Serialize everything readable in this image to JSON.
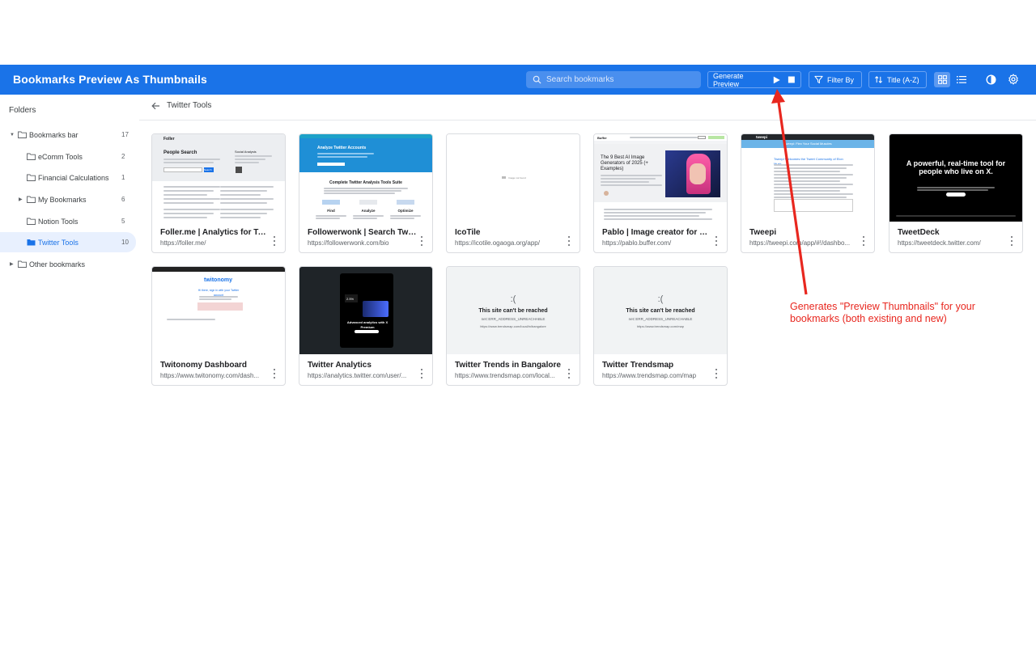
{
  "app": {
    "title": "Bookmarks Preview As Thumbnails"
  },
  "search": {
    "placeholder": "Search bookmarks"
  },
  "toolbar": {
    "generate_label": "Generate Preview",
    "filter_label": "Filter By",
    "sort_label": "Title (A-Z)"
  },
  "sidebar": {
    "heading": "Folders",
    "items": [
      {
        "label": "Bookmarks bar",
        "count": "17",
        "level": 0,
        "expanded": true
      },
      {
        "label": "eComm Tools",
        "count": "2",
        "level": 1
      },
      {
        "label": "Financial Calculations",
        "count": "1",
        "level": 1
      },
      {
        "label": "My Bookmarks",
        "count": "6",
        "level": 1,
        "collapsed": true
      },
      {
        "label": "Notion Tools",
        "count": "5",
        "level": 1
      },
      {
        "label": "Twitter Tools",
        "count": "10",
        "level": 1,
        "active": true
      },
      {
        "label": "Other bookmarks",
        "count": "",
        "level": 0,
        "collapsed": true
      }
    ]
  },
  "breadcrumb": {
    "current": "Twitter Tools"
  },
  "bookmarks": [
    {
      "title": "Foller.me | Analytics for Twit...",
      "url": "https://foller.me/",
      "thumb": {
        "brand": "Foller",
        "heading": "People Search",
        "side": "Social Analysis",
        "button": "Search"
      }
    },
    {
      "title": "Followerwonk | Search Twitt...",
      "url": "https://followerwonk.com/bio",
      "thumb": {
        "heading": "Analyze Twitter Accounts",
        "section": "Complete Twitter Analysis Tools Suite",
        "cols": [
          "Find",
          "Analyze",
          "Optimize"
        ]
      }
    },
    {
      "title": "IcoTile",
      "url": "https://icotile.ogaoga.org/app/",
      "thumb": {
        "text": "Image not found"
      }
    },
    {
      "title": "Pablo | Image creator for soc...",
      "url": "https://pablo.buffer.com/",
      "thumb": {
        "brand": "Buffer",
        "heading": "The 9 Best AI Image Generators of 2025 (+ Examples)"
      }
    },
    {
      "title": "Tweepi",
      "url": "https://tweepi.com/app/#!/dashbo...",
      "thumb": {
        "brand": "tweepi",
        "banner": "Tweepi: Flex Your Social Muscles",
        "heading": "Tweepi Welcomes the Tweet Community of Elon Musk"
      }
    },
    {
      "title": "TweetDeck",
      "url": "https://tweetdeck.twitter.com/",
      "thumb": {
        "heading": "A powerful, real-time tool for people who live on X."
      }
    },
    {
      "title": "Twitonomy Dashboard",
      "url": "https://www.twitonomy.com/dash...",
      "thumb": {
        "brand": "twitonomy",
        "heading": "Hi there, sign in with your Twitter account"
      }
    },
    {
      "title": "Twitter Analytics",
      "url": "https://analytics.twitter.com/user/...",
      "thumb": {
        "heading": "Advanced analytics with X Premium",
        "stat": "2.5%"
      }
    },
    {
      "title": "Twitter Trends in Bangalore",
      "url": "https://www.trendsmap.com/local...",
      "thumb": {
        "face": ":(",
        "error": "This site can't be reached",
        "code": "net::ERR_ADDRESS_UNREACHABLE",
        "url": "https://www.trendsmap.com/local/in/bangalore"
      }
    },
    {
      "title": "Twitter Trendsmap",
      "url": "https://www.trendsmap.com/map",
      "thumb": {
        "face": ":(",
        "error": "This site can't be reached",
        "code": "net::ERR_ADDRESS_UNREACHABLE",
        "url": "https://www.trendsmap.com/map"
      }
    }
  ],
  "annotation": {
    "text": "Generates \"Preview Thumbnails\" for your bookmarks (both existing and new)"
  },
  "colors": {
    "accent": "#1a73e8",
    "annotation": "#e8271f",
    "active_bg": "#e8f0fe"
  }
}
